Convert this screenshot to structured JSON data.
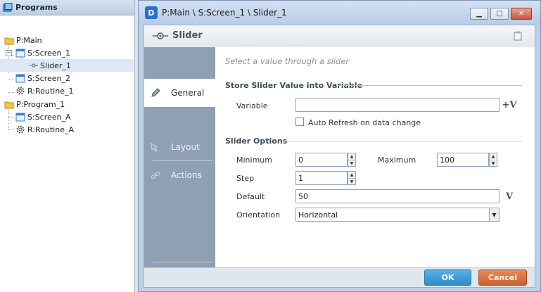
{
  "tree": {
    "header": "Programs",
    "items": [
      {
        "label": "P:Main",
        "icon": "folder-icon"
      },
      {
        "label": "S:Screen_1",
        "icon": "screen-icon"
      },
      {
        "label": "Slider_1",
        "icon": "slider-icon"
      },
      {
        "label": "S:Screen_2",
        "icon": "screen-icon"
      },
      {
        "label": "R:Routine_1",
        "icon": "gear-icon"
      },
      {
        "label": "P:Program_1",
        "icon": "folder-icon"
      },
      {
        "label": "S:Screen_A",
        "icon": "screen-icon"
      },
      {
        "label": "R:Routine_A",
        "icon": "gear-icon"
      }
    ]
  },
  "window": {
    "app_icon": "D",
    "title": "P:Main \\ S:Screen_1 \\ Slider_1",
    "minimize": "▁",
    "maximize": "▢",
    "close": "✕"
  },
  "panel": {
    "title": "Slider"
  },
  "nav": {
    "items": [
      {
        "label": "General"
      },
      {
        "label": "Layout"
      },
      {
        "label": "Actions"
      }
    ]
  },
  "form": {
    "hint": "Select a value through a slider",
    "store_section": "Store Slider Value into Variable",
    "variable_label": "Variable",
    "variable_value": "",
    "variable_btn": "+V",
    "auto_refresh_label": "Auto Refresh on data change",
    "options_section": "Slider Options",
    "minimum_label": "Minimum",
    "minimum_value": "0",
    "maximum_label": "Maximum",
    "maximum_value": "100",
    "step_label": "Step",
    "step_value": "1",
    "default_label": "Default",
    "default_value": "50",
    "default_btn": "V",
    "orientation_label": "Orientation",
    "orientation_value": "Horizontal"
  },
  "footer": {
    "ok": "OK",
    "cancel": "Cancel"
  }
}
